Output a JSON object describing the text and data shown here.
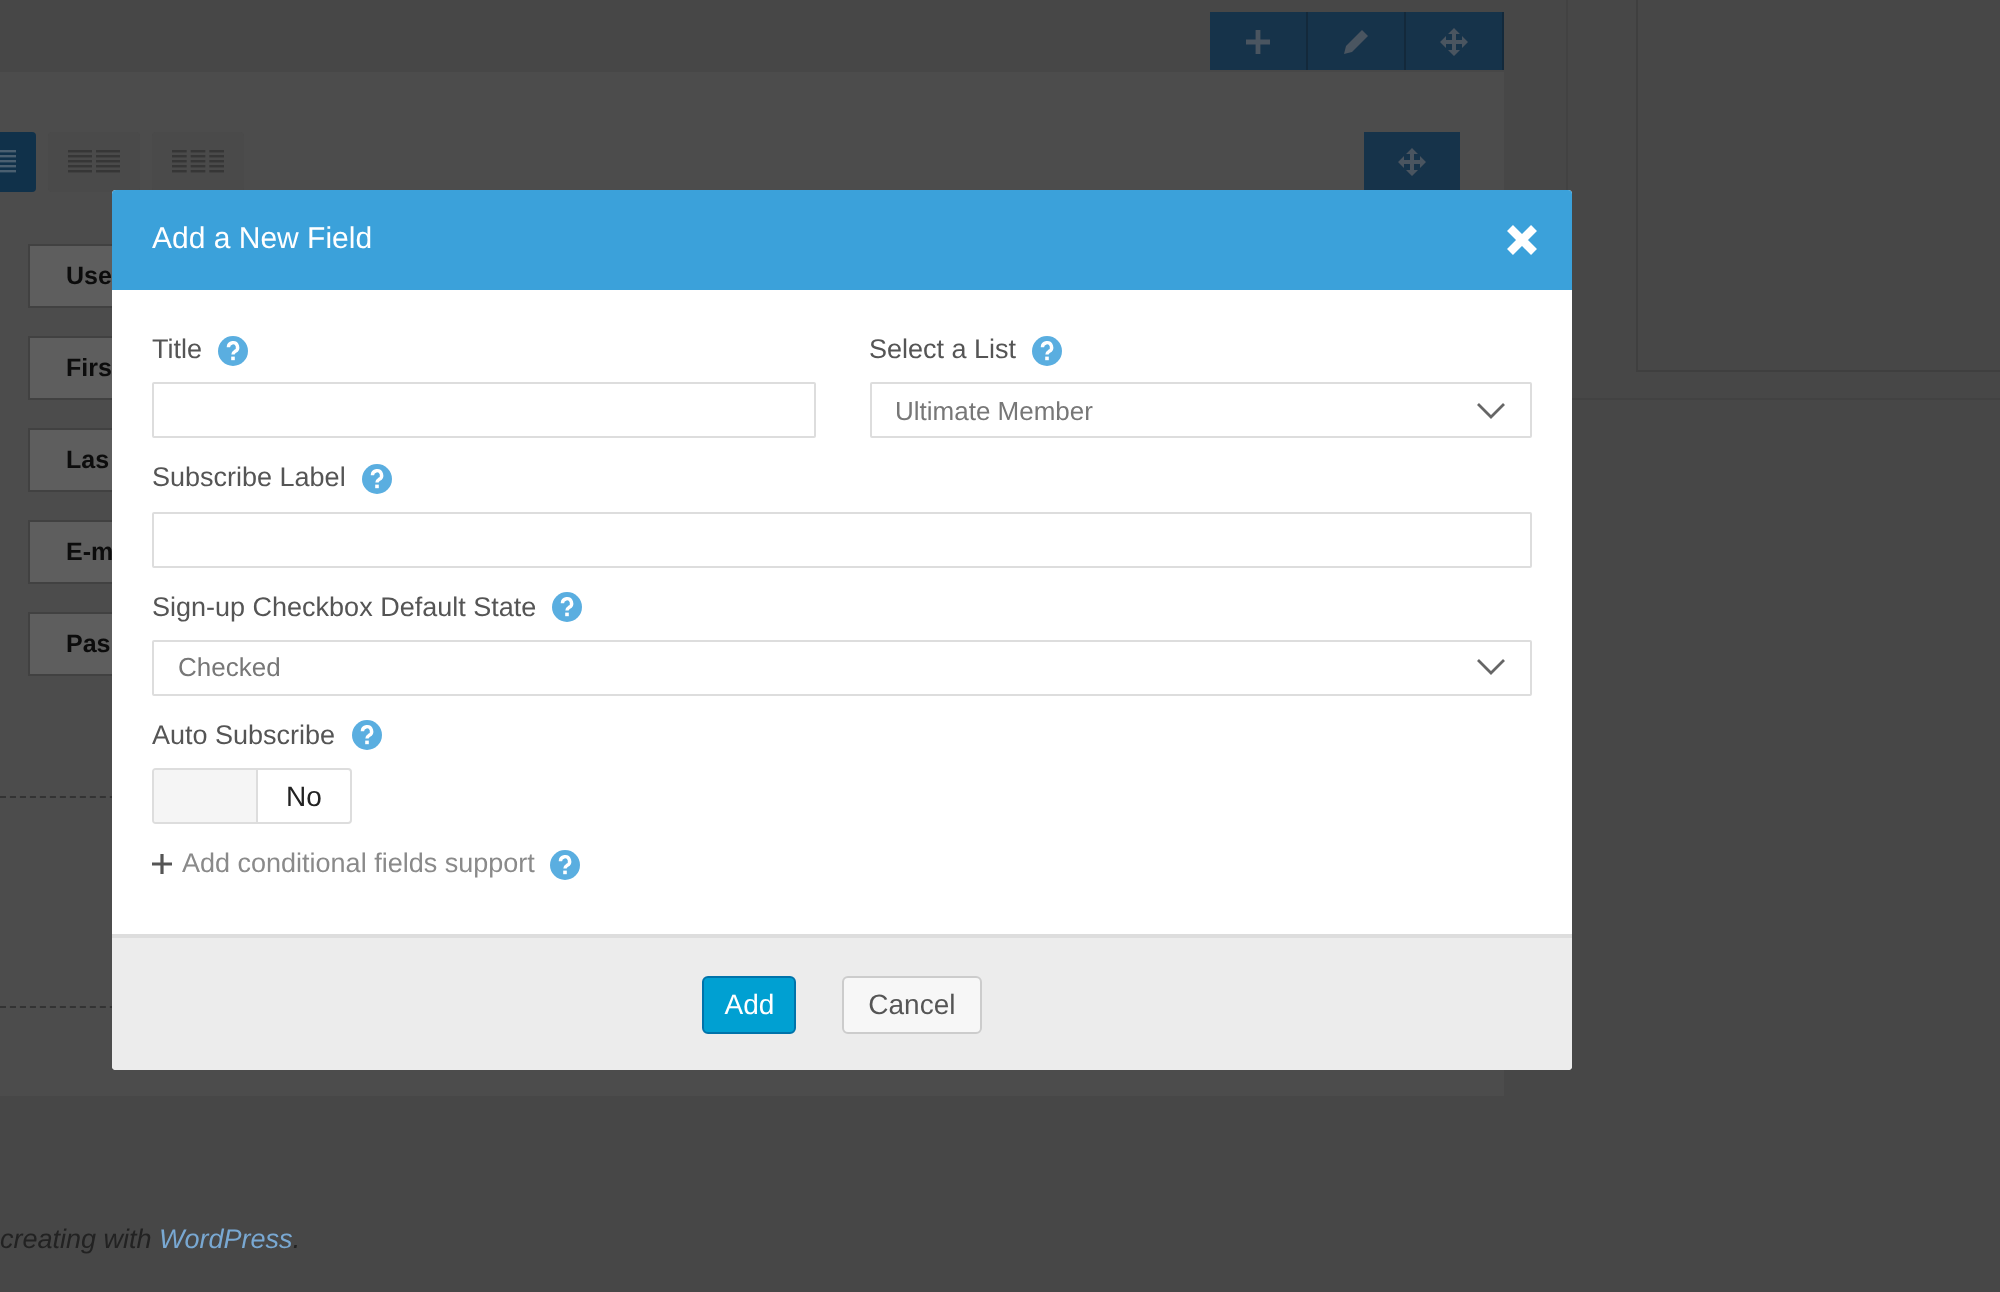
{
  "builder": {
    "layouts": [
      {
        "selected": true
      },
      {
        "selected": false
      },
      {
        "selected": false
      }
    ],
    "fields": [
      "Use",
      "Firs",
      "Las",
      "E-m",
      "Pas"
    ]
  },
  "footer": {
    "text": "creating with ",
    "link": "WordPress",
    "end": "."
  },
  "modal": {
    "title": "Add a New Field",
    "rows": [
      {
        "fields": [
          {
            "kind": "text",
            "label": "Title"
          },
          {
            "kind": "select",
            "label": "Select a List",
            "value": "Ultimate Member"
          }
        ]
      },
      {
        "fields": [
          {
            "kind": "text",
            "label": "Subscribe Label"
          }
        ]
      },
      {
        "fields": [
          {
            "kind": "select",
            "label": "Sign-up Checkbox Default State",
            "value": "Checked"
          }
        ]
      },
      {
        "fields": [
          {
            "kind": "toggle",
            "label": "Auto Subscribe",
            "on": false,
            "state_text": "No"
          }
        ]
      }
    ],
    "link": "Add conditional fields support",
    "buttons": [
      {
        "label": "Add",
        "kind": "primary"
      },
      {
        "label": "Cancel",
        "kind": "default"
      }
    ]
  }
}
